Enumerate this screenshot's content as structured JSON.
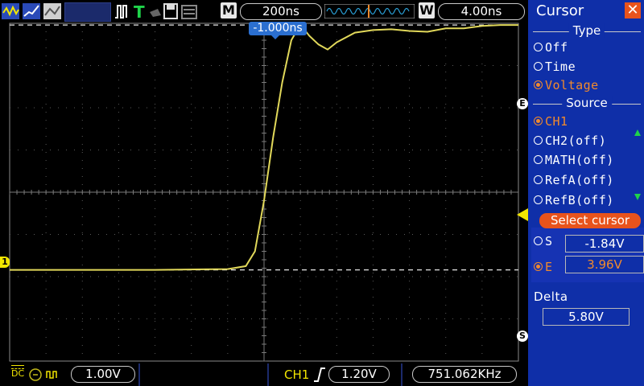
{
  "top_bar": {
    "timebase": "200ns",
    "memory_label": "M",
    "window_label": "W",
    "window_value": "4.00ns",
    "trigger_position": "-1.000ns"
  },
  "bottom_bar": {
    "coupling_label": "DC",
    "ch1_scale": "1.00V",
    "trigger_source": "CH1",
    "trigger_level": "1.20V",
    "frequency": "751.062KHz"
  },
  "screen": {
    "ch1_marker": "1",
    "cursor_s_marker": "S",
    "cursor_e_marker": "E"
  },
  "panel": {
    "title": "Cursor",
    "type_heading": "Type",
    "type_options": [
      {
        "label": "Off",
        "selected": false
      },
      {
        "label": "Time",
        "selected": false
      },
      {
        "label": "Voltage",
        "selected": true
      }
    ],
    "source_heading": "Source",
    "source_options": [
      {
        "label": "CH1",
        "selected": true
      },
      {
        "label": "CH2(off)",
        "selected": false
      },
      {
        "label": "MATH(off)",
        "selected": false
      },
      {
        "label": "RefA(off)",
        "selected": false
      },
      {
        "label": "RefB(off)",
        "selected": false
      }
    ],
    "select_cursor_label": "Select cursor",
    "cursor_s": {
      "label": "S",
      "value": "-1.84V",
      "selected": false
    },
    "cursor_e": {
      "label": "E",
      "value": "3.96V",
      "selected": true
    },
    "delta_label": "Delta",
    "delta_value": "5.80V"
  },
  "colors": {
    "trace": "#e1d85a",
    "panel_bg": "#0f2fa8",
    "accent": "#e8531c",
    "selected_text": "#f28a2c",
    "trigger_marker": "#f2e600"
  },
  "chart_data": {
    "type": "line",
    "title": "",
    "xlabel": "",
    "ylabel": "",
    "x_unit": "ns",
    "y_unit": "V",
    "xlim": [
      -1400,
      1400
    ],
    "ylim": [
      -4,
      4
    ],
    "series": [
      {
        "x": [
          -1400,
          -1000,
          -600,
          -200,
          -100,
          -50,
          0,
          50,
          100,
          150,
          200,
          250,
          300,
          350,
          400,
          500,
          600,
          700,
          800,
          900,
          1000,
          1100,
          1200,
          1300,
          1400
        ],
        "y": [
          -1.84,
          -1.84,
          -1.84,
          -1.82,
          -1.75,
          -1.4,
          -0.2,
          1.3,
          2.6,
          3.6,
          3.97,
          3.7,
          3.5,
          3.38,
          3.55,
          3.78,
          3.84,
          3.86,
          3.82,
          3.8,
          3.88,
          3.88,
          3.94,
          3.96,
          3.96
        ]
      }
    ],
    "cursors": {
      "S": -1.84,
      "E": 3.96
    },
    "trigger_level": 1.2
  }
}
